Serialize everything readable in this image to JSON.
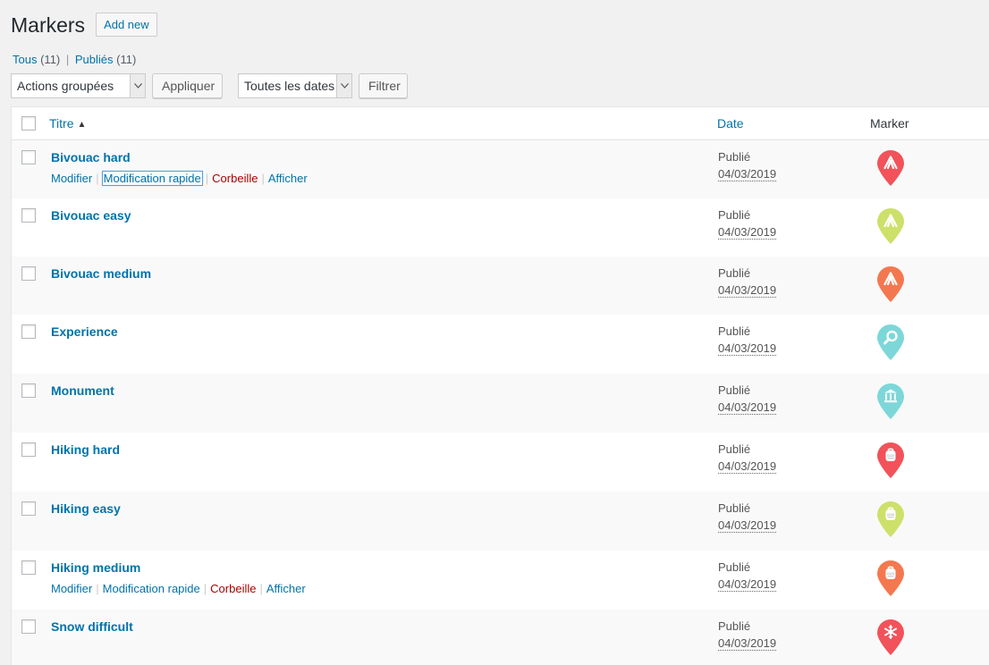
{
  "header": {
    "title": "Markers",
    "add_new_label": "Add new"
  },
  "views": {
    "all_label": "Tous",
    "all_count": "(11)",
    "separator": "|",
    "published_label": "Publiés",
    "published_count": "(11)"
  },
  "tablenav": {
    "bulk_select": "Actions groupées",
    "apply_label": "Appliquer",
    "dates_select": "Toutes les dates",
    "filter_label": "Filtrer"
  },
  "table": {
    "columns": {
      "title": "Titre",
      "date": "Date",
      "marker": "Marker"
    },
    "actions": {
      "edit": "Modifier",
      "quick_edit": "Modification rapide",
      "trash": "Corbeille",
      "view": "Afficher"
    },
    "rows": [
      {
        "title": "Bivouac hard",
        "status": "Publié",
        "date": "04/03/2019",
        "marker_color": "#f2525a",
        "marker_icon": "tent-icon",
        "show_actions": true,
        "quick_edit_focused": true
      },
      {
        "title": "Bivouac easy",
        "status": "Publié",
        "date": "04/03/2019",
        "marker_color": "#cde06a",
        "marker_icon": "tent-icon",
        "show_actions": false
      },
      {
        "title": "Bivouac medium",
        "status": "Publié",
        "date": "04/03/2019",
        "marker_color": "#f4784f",
        "marker_icon": "tent-icon",
        "show_actions": false
      },
      {
        "title": "Experience",
        "status": "Publié",
        "date": "04/03/2019",
        "marker_color": "#7dd7d8",
        "marker_icon": "magnifier-icon",
        "show_actions": false
      },
      {
        "title": "Monument",
        "status": "Publié",
        "date": "04/03/2019",
        "marker_color": "#7dd7d8",
        "marker_icon": "monument-icon",
        "show_actions": false
      },
      {
        "title": "Hiking hard",
        "status": "Publié",
        "date": "04/03/2019",
        "marker_color": "#f2525a",
        "marker_icon": "backpack-icon",
        "show_actions": false
      },
      {
        "title": "Hiking easy",
        "status": "Publié",
        "date": "04/03/2019",
        "marker_color": "#cde06a",
        "marker_icon": "backpack-icon",
        "show_actions": false
      },
      {
        "title": "Hiking medium",
        "status": "Publié",
        "date": "04/03/2019",
        "marker_color": "#f4784f",
        "marker_icon": "backpack-icon",
        "show_actions": true,
        "quick_edit_focused": false
      },
      {
        "title": "Snow difficult",
        "status": "Publié",
        "date": "04/03/2019",
        "marker_color": "#f2525a",
        "marker_icon": "snowflake-icon",
        "show_actions": false
      }
    ]
  }
}
